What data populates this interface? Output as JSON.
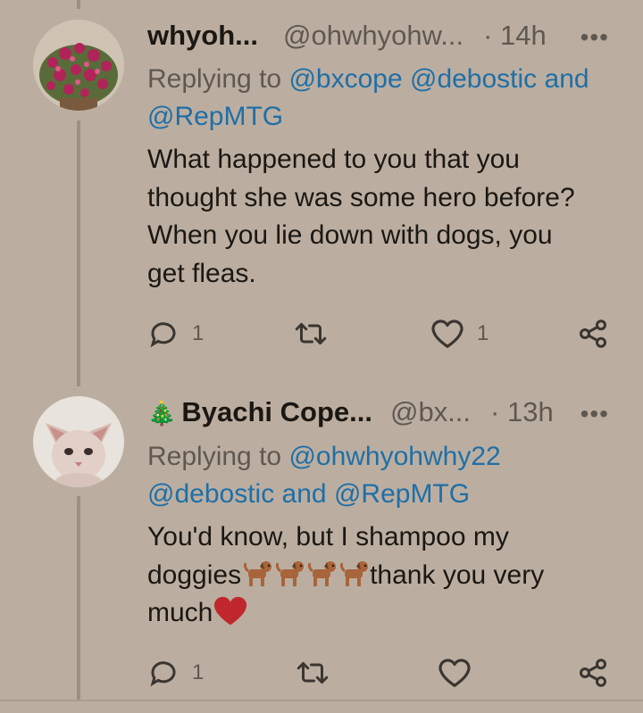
{
  "tweets": [
    {
      "name": "whyoh...",
      "handle": "@ohwhyohw...",
      "time": "· 14h",
      "more_label": "•••",
      "reply_prefix": "Replying to",
      "reply_mentions_line1": [
        "@bxcope",
        "@debostic"
      ],
      "reply_and": "and",
      "reply_mentions_line2": [
        "@RepMTG"
      ],
      "text_lines": [
        "What happened to you that you",
        "thought she was some hero before?",
        "When you lie down with dogs, you",
        "get fleas."
      ],
      "reply_count": "1",
      "retweet_count": "",
      "like_count": "1",
      "avatar_icon": "flowering-plant-avatar"
    },
    {
      "name_emoji": "🎄",
      "name": "Byachi Cope...",
      "handle": "@bx...",
      "time": "· 13h",
      "more_label": "•••",
      "reply_prefix": "Replying to",
      "reply_mention1": "@ohwhyohwhy22",
      "reply_mention2": "@debostic",
      "reply_and": "and",
      "reply_mention3": "@RepMTG",
      "text_line1": "You'd know, but I shampoo my",
      "text_line2_start": "doggies",
      "text_line2_end": "thank you very",
      "text_line3": "much",
      "dog_emoji_count": 4,
      "reply_count": "1",
      "retweet_count": "",
      "like_count": "",
      "avatar_icon": "hairless-kitten-avatar"
    }
  ],
  "colors": {
    "background": "#bbaea1",
    "link": "#1f6fa6",
    "secondary_text": "#5f5851",
    "heart_emoji": "#c0282e"
  }
}
